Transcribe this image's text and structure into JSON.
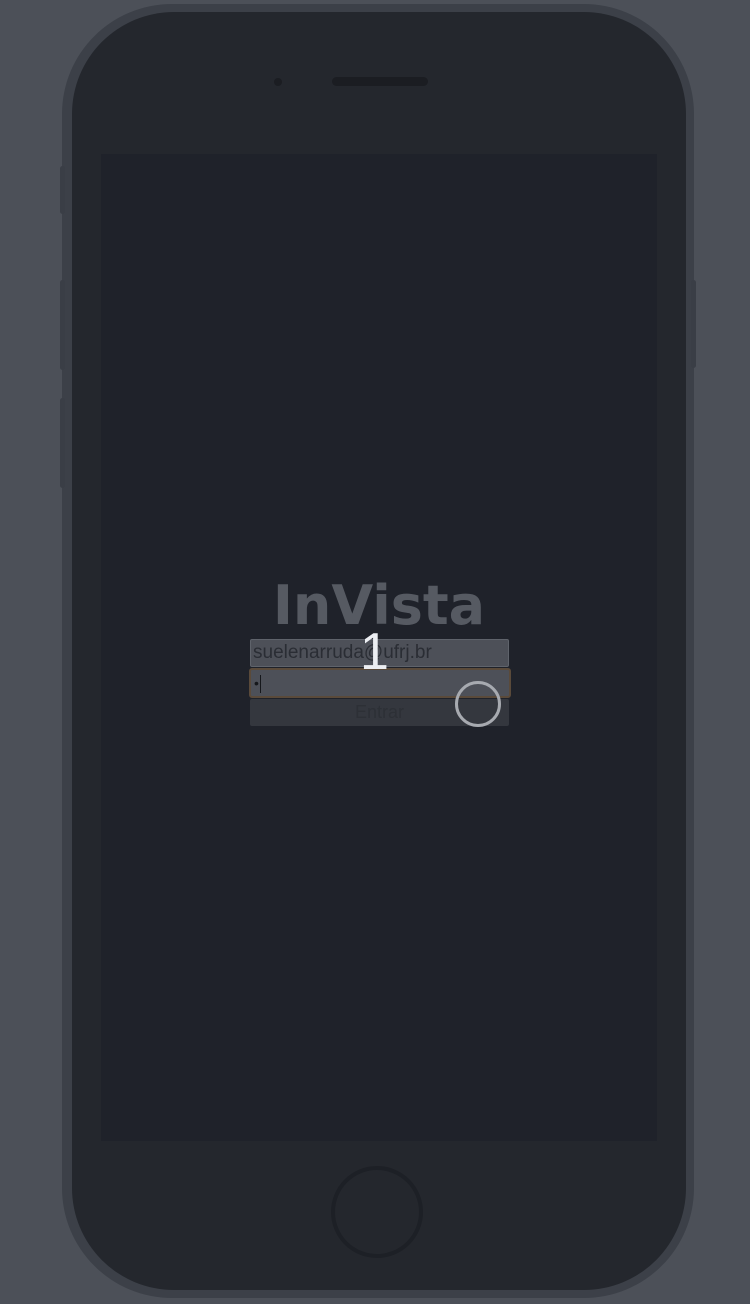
{
  "app": {
    "brand": "InVista"
  },
  "login": {
    "email_value": "suelenarruda@ufrj.br",
    "password_mask": "•",
    "submit_label": "Entrar"
  },
  "overlay": {
    "step_number": "1"
  },
  "colors": {
    "device_frame": "#3c4048",
    "screen_background": "#1f222a",
    "brand_text": "#565a62",
    "field_background": "#4d5058"
  },
  "icons": {
    "touch_indicator": "circle-ring",
    "home_button": "circle"
  }
}
